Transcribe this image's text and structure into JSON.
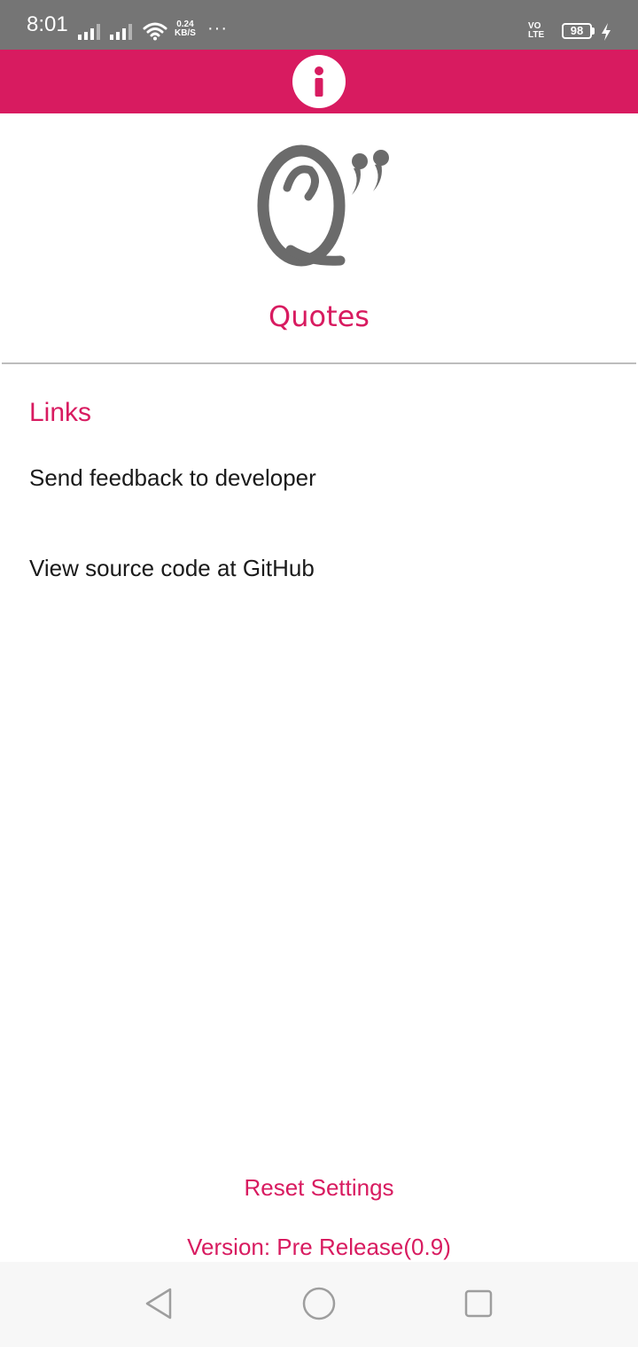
{
  "status_bar": {
    "time": "8:01",
    "speed_value": "0.24",
    "speed_unit": "KB/S",
    "overflow": "···",
    "volte_top": "VO",
    "volte_bottom": "LTE",
    "battery": "98",
    "icons": [
      "signal-icon",
      "signal-icon",
      "wifi-icon",
      "charging-icon"
    ]
  },
  "app_bar": {
    "icon": "info-icon"
  },
  "header": {
    "logo_icon": "quotes-logo-icon",
    "app_name": "Quotes"
  },
  "links": {
    "title": "Links",
    "items": [
      {
        "label": "Send feedback to developer"
      },
      {
        "label": "View source code at GitHub"
      }
    ]
  },
  "footer": {
    "reset_label": "Reset Settings",
    "version_text": "Version: Pre Release(0.9)"
  },
  "nav_bar": {
    "icons": [
      "back-icon",
      "home-icon",
      "recents-icon"
    ]
  },
  "colors": {
    "accent": "#d81b60",
    "status_bar": "#757575",
    "nav_bar": "#f7f7f7",
    "logo_gray": "#6b6b6b"
  }
}
